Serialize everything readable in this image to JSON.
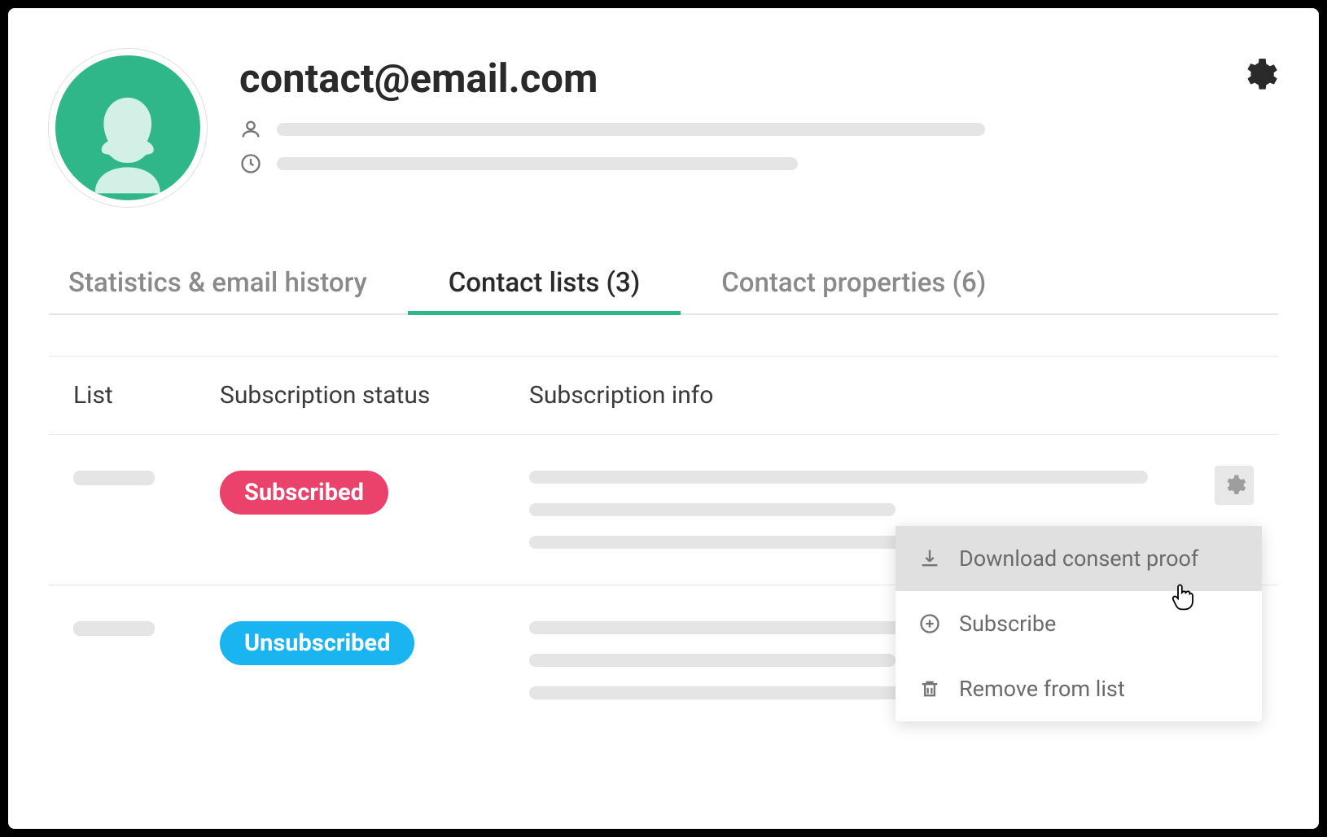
{
  "header": {
    "email": "contact@email.com"
  },
  "tabs": [
    {
      "label": "Statistics & email history"
    },
    {
      "label": "Contact lists (3)"
    },
    {
      "label": "Contact properties (6)"
    }
  ],
  "columns": {
    "list": "List",
    "status": "Subscription status",
    "info": "Subscription info"
  },
  "rows": [
    {
      "status_label": "Subscribed",
      "status_class": "subscribed"
    },
    {
      "status_label": "Unsubscribed",
      "status_class": "unsubscribed"
    }
  ],
  "menu": {
    "download": "Download consent proof",
    "subscribe": "Subscribe",
    "remove": "Remove from list"
  }
}
